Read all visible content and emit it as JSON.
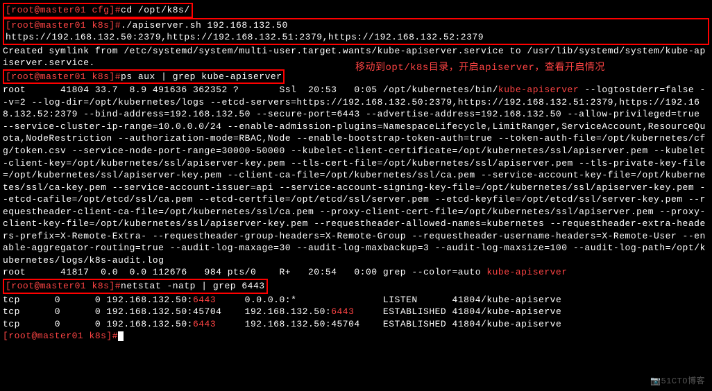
{
  "prompts": {
    "cfg": "[root@master01 cfg]#",
    "k8s": "[root@master01 k8s]#"
  },
  "commands": {
    "cd": "cd /opt/k8s/",
    "apiserver": "./apiserver.sh 192.168.132.50 https://192.168.132.50:2379,https://192.168.132.51:2379,https://192.168.132.52:2379",
    "ps": "ps aux | grep kube-apiserver",
    "netstat": "netstat -natp | grep 6443"
  },
  "output": {
    "symlink": "Created symlink from /etc/systemd/system/multi-user.target.wants/kube-apiserver.service to /usr/lib/systemd/system/kube-apiserver.service.",
    "ps_prefix": "root      41804 33.7  8.9 491636 362352 ?       Ssl  20:53   0:05 /opt/kubernetes/bin/",
    "ps_highlight": "kube-apiserver",
    "ps_body": " --logtostderr=false --v=2 --log-dir=/opt/kubernetes/logs --etcd-servers=https://192.168.132.50:2379,https://192.168.132.51:2379,https://192.168.132.52:2379 --bind-address=192.168.132.50 --secure-port=6443 --advertise-address=192.168.132.50 --allow-privileged=true --service-cluster-ip-range=10.0.0.0/24 --enable-admission-plugins=NamespaceLifecycle,LimitRanger,ServiceAccount,ResourceQuota,NodeRestriction --authorization-mode=RBAC,Node --enable-bootstrap-token-auth=true --token-auth-file=/opt/kubernetes/cfg/token.csv --service-node-port-range=30000-50000 --kubelet-client-certificate=/opt/kubernetes/ssl/apiserver.pem --kubelet-client-key=/opt/kubernetes/ssl/apiserver-key.pem --tls-cert-file=/opt/kubernetes/ssl/apiserver.pem --tls-private-key-file=/opt/kubernetes/ssl/apiserver-key.pem --client-ca-file=/opt/kubernetes/ssl/ca.pem --service-account-key-file=/opt/kubernetes/ssl/ca-key.pem --service-account-issuer=api --service-account-signing-key-file=/opt/kubernetes/ssl/apiserver-key.pem --etcd-cafile=/opt/etcd/ssl/ca.pem --etcd-certfile=/opt/etcd/ssl/server.pem --etcd-keyfile=/opt/etcd/ssl/server-key.pem --requestheader-client-ca-file=/opt/kubernetes/ssl/ca.pem --proxy-client-cert-file=/opt/kubernetes/ssl/apiserver.pem --proxy-client-key-file=/opt/kubernetes/ssl/apiserver-key.pem --requestheader-allowed-names=kubernetes --requestheader-extra-headers-prefix=X-Remote-Extra- --requestheader-group-headers=X-Remote-Group --requestheader-username-headers=X-Remote-User --enable-aggregator-routing=true --audit-log-maxage=30 --audit-log-maxbackup=3 --audit-log-maxsize=100 --audit-log-path=/opt/kubernetes/logs/k8s-audit.log",
    "grep_prefix": "root      41817  0.0  0.0 112676   984 pts/0    R+   20:54   0:00 grep --color=auto ",
    "grep_highlight": "kube-apiserver",
    "netstat_rows": [
      {
        "proto": "tcp",
        "recv": "0",
        "send": "0",
        "local_ip": "192.168.132.50:",
        "local_port": "6443",
        "remote": "0.0.0.0:*",
        "state": "LISTEN",
        "pid": "41804/kube-apiserve"
      },
      {
        "proto": "tcp",
        "recv": "0",
        "send": "0",
        "local_ip": "192.168.132.50:45704",
        "local_port": "",
        "remote_ip": "192.168.132.50:",
        "remote_port": "6443",
        "state": "ESTABLISHED",
        "pid": "41804/kube-apiserve"
      },
      {
        "proto": "tcp",
        "recv": "0",
        "send": "0",
        "local_ip": "192.168.132.50:",
        "local_port": "6443",
        "remote": "192.168.132.50:45704",
        "state": "ESTABLISHED",
        "pid": "41804/kube-apiserve"
      }
    ]
  },
  "annotation": "移动到opt/k8s目录，开启apiserver，查看开启情况",
  "watermark": "51CTO博客"
}
